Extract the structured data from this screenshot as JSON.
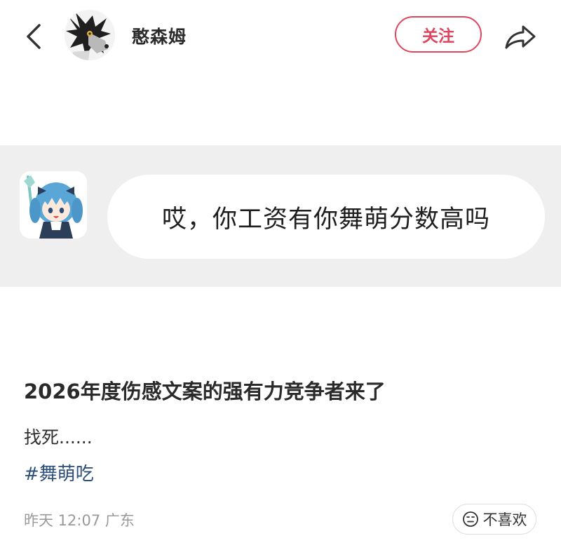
{
  "header": {
    "back_icon": "chevron-left-icon",
    "username": "憨森姆",
    "follow_label": "关注",
    "share_icon": "share-arrow-icon"
  },
  "post_image": {
    "chat_message": "哎，你工资有你舞萌分数高吗"
  },
  "post": {
    "title": "2026年度伤感文案的强有力竞争者来了",
    "body": "找死......",
    "tag": "#舞萌吃"
  },
  "footer": {
    "meta": "昨天 12:07 广东",
    "dislike_label": "不喜欢",
    "dislike_icon": "meh-face-icon"
  },
  "colors": {
    "accent": "#e0455e",
    "tag": "#2e4f7a",
    "meta": "#9a9a9a",
    "image_bg": "#efefef"
  }
}
